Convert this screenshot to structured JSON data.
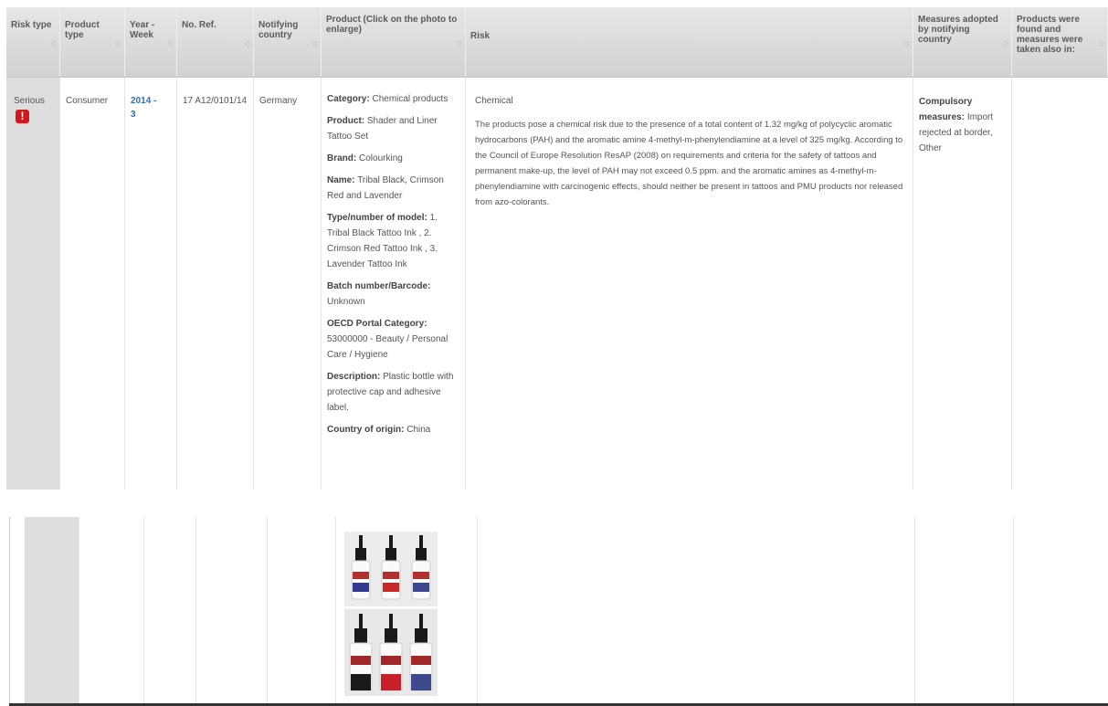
{
  "headers": {
    "risk_type": "Risk type",
    "product_type": "Product type",
    "year_week": "Year - Week",
    "no_ref": "No. Ref.",
    "notifying_country": "Notifying country",
    "product": "Product (Click on the photo to enlarge)",
    "risk": "Risk",
    "measures": "Measures adopted by notifying country",
    "products_found": "Products were found and measures were taken also in:"
  },
  "row": {
    "risk_type": "Serious",
    "warning_icon": "exclamation-icon",
    "product_type": "Consumer",
    "year_week": "2014 - 3",
    "no_ref": "17 A12/0101/14",
    "notifying_country": "Germany",
    "product": {
      "category_label": "Category:",
      "category": "Chemical products",
      "product_label": "Product:",
      "product": "Shader and Liner Tattoo Set",
      "brand_label": "Brand:",
      "brand": "Colourking",
      "name_label": "Name:",
      "name": "Tribal Black, Crimson Red and Lavender",
      "model_label": "Type/number of model:",
      "model": "1. Tribal Black Tattoo Ink , 2. Crimson Red Tattoo Ink , 3. Lavender Tattoo Ink",
      "batch_label": "Batch number/Barcode:",
      "batch": "Unknown",
      "oecd_label": "OECD Portal Category:",
      "oecd": "53000000 - Beauty / Personal Care / Hygiene",
      "description_label": "Description:",
      "description": "Plastic bottle with protective cap and adhesive label.",
      "origin_label": "Country of origin:",
      "origin": "China"
    },
    "risk": {
      "type": "Chemical",
      "description": "The products pose a chemical risk due to the presence of a total content of 1.32 mg/kg of polycyclic aromatic hydrocarbons (PAH) and the aromatic amine 4-methyl-m-phenylendiamine at a level of 325 mg/kg. According to the Council of Europe Resolution ResAP (2008) on requirements and criteria for the safety of tattoos and permanent make-up, the level of PAH may not exceed 0.5 ppm. and the aromatic amines as 4-methyl-m-phenylendiamine with carcinogenic effects, should neither be present in tattoos and PMU products nor released from azo-colorants."
    },
    "measures": {
      "label": "Compulsory measures:",
      "value": "Import rejected at border, Other"
    },
    "products_found": ""
  },
  "sort_icon": "sort-icon",
  "colors": {
    "header_bg": "#d9d9d9",
    "first_col_bg": "#dedede",
    "link": "#2c6fb5",
    "warning": "#d0181d",
    "ink_black": "#1a1a1a",
    "ink_red": "#c8202a",
    "ink_lavender": "#3c4a8c"
  }
}
